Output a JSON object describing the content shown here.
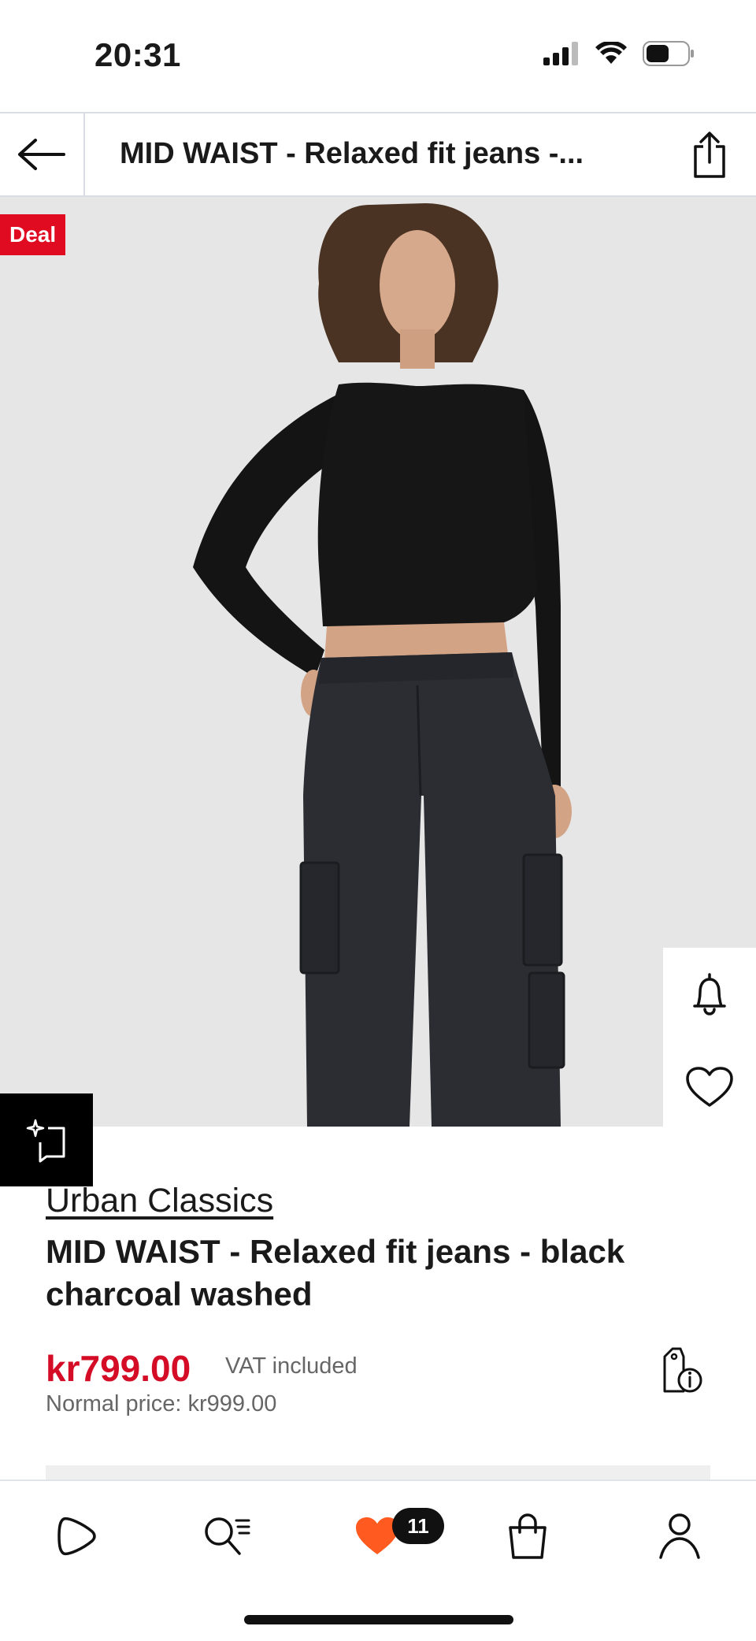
{
  "status_bar": {
    "time": "20:31"
  },
  "header": {
    "title": "MID WAIST  - Relaxed fit jeans -..."
  },
  "product": {
    "deal_badge": "Deal",
    "brand": "Urban Classics",
    "name": "MID WAIST  - Relaxed fit jeans - black charcoal washed",
    "price": "kr799.00",
    "vat_text": "VAT included",
    "normal_price": "Normal price: kr999.00"
  },
  "bottom_nav": {
    "items": [
      "home-icon",
      "search-icon",
      "heart-icon",
      "bag-icon",
      "profile-icon"
    ],
    "wishlist_count": "11"
  },
  "colors": {
    "accent": "#d50c26",
    "deal": "#e00b21",
    "wishlist_heart": "#ff5a1f",
    "image_bg": "#e6e6e6"
  }
}
